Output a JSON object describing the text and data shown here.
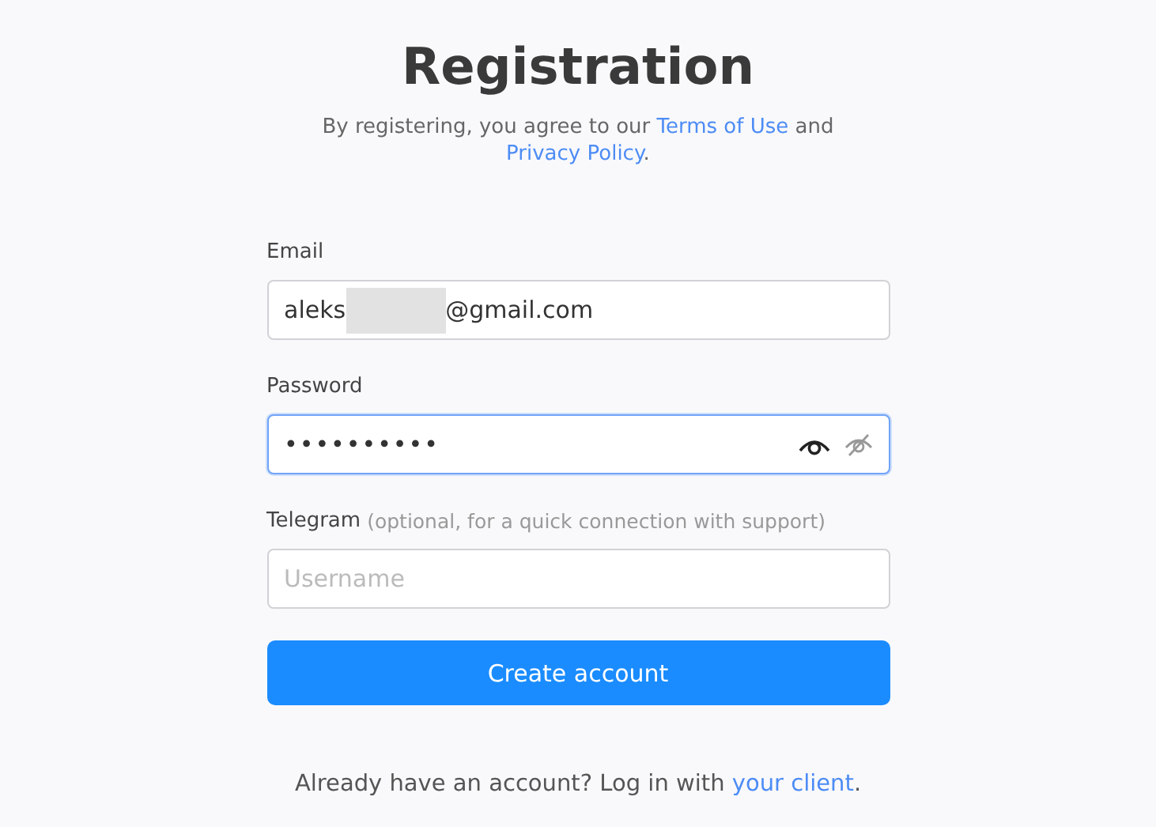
{
  "title": "Registration",
  "agreement": {
    "before": "By registering, you agree to our",
    "terms_link": "Terms of Use",
    "between": "and",
    "privacy_link": "Privacy Policy",
    "after": "."
  },
  "fields": [
    {
      "kind": "email",
      "label": "Email",
      "value_start": "aleks",
      "redacted": true,
      "value_end": "@gmail.com",
      "focused": false
    },
    {
      "kind": "password",
      "label": "Password",
      "value": "••••••••••",
      "focused": true
    },
    {
      "kind": "text",
      "label": "Telegram",
      "hint": "(optional, for a quick connection with support)",
      "placeholder": "Username",
      "focused": false
    }
  ],
  "submit": "Create account",
  "login": {
    "text": "Already have an account? Log in with",
    "link": "your client",
    "after": "."
  }
}
